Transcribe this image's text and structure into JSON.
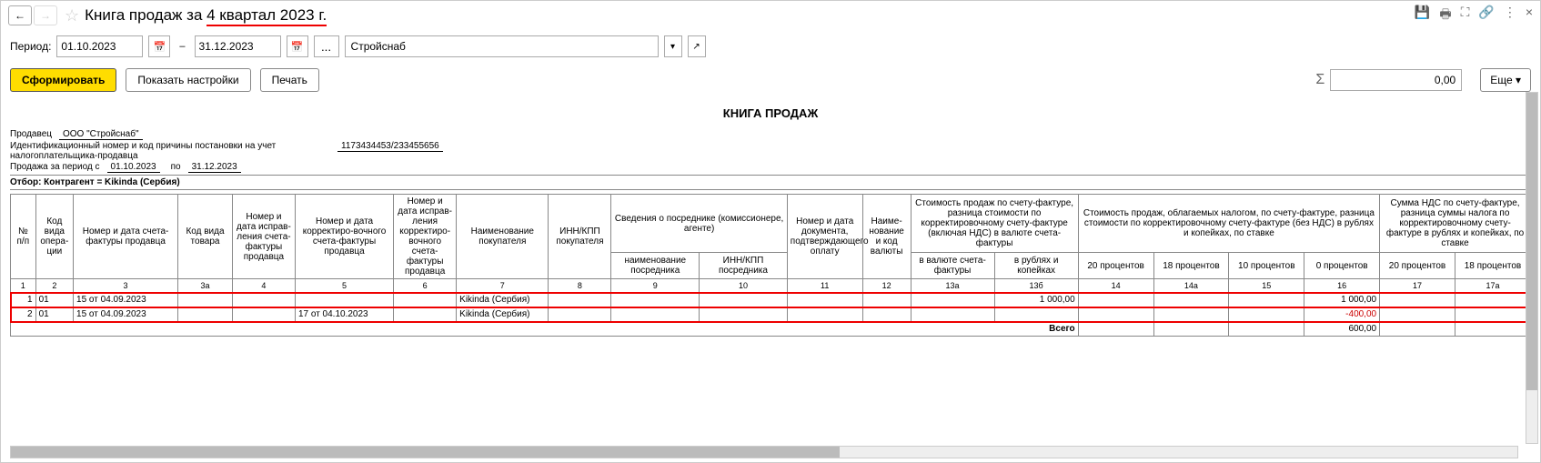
{
  "titlebar": {
    "title_prefix": "Книга продаж за ",
    "title_highlight": "4 квартал 2023 г."
  },
  "toolbar": {
    "period_label": "Период:",
    "date_from": "01.10.2023",
    "date_to": "31.12.2023",
    "dots": "...",
    "org": "Стройснаб"
  },
  "actions": {
    "generate": "Сформировать",
    "settings": "Показать настройки",
    "print": "Печать",
    "sum_value": "0,00",
    "more": "Еще"
  },
  "report": {
    "title": "КНИГА ПРОДАЖ",
    "seller_label": "Продавец",
    "seller": "ООО \"Стройснаб\"",
    "inn_label": "Идентификационный номер и код причины постановки на учет налогоплательщика-продавца",
    "inn": "1173434453/233455656",
    "period_label_from": "Продажа за период с",
    "period_from": "01.10.2023",
    "period_label_to": "по",
    "period_to": "31.12.2023",
    "filter": "Отбор: Контрагент = Kikinda (Сербия)"
  },
  "headers": {
    "n": "№ п/п",
    "op": "Код вида опера-ции",
    "sf": "Номер и дата счета-фактуры продавца",
    "kind": "Код вида товара",
    "corr": "Номер и дата исправ-ления счета-фактуры продавца",
    "corrd": "Номер и дата корректиро-вочного счета-фактуры продавца",
    "corr2": "Номер и дата исправ-ления корректиро-вочного счета-фактуры продавца",
    "buyer": "Наименование покупателя",
    "inn": "ИНН/КПП покупателя",
    "agent_group": "Сведения о посреднике (комиссионере, агенте)",
    "agent1": "наименование посредника",
    "agent2": "ИНН/КПП посредника",
    "pay": "Номер и дата документа, подтверждающего оплату",
    "cur": "Наиме-нование и код валюты",
    "cost_group": "Стоимость продаж по счету-фактуре, разница стоимости по корректировочному счету-фактуре (включая НДС) в валюте счета-фактуры",
    "cost1": "в валюте счета-фактуры",
    "cost2": "в рублях и копейках",
    "taxable_group": "Стоимость продаж, облагаемых налогом, по счету-фактуре, разница стоимости по корректировочному счету-фактуре (без НДС) в рублях и копейках, по ставке",
    "p20": "20 процентов",
    "p18": "18 процентов",
    "p10": "10 процентов",
    "p0": "0 процентов",
    "vat_group": "Сумма НДС по счету-фактуре, разница суммы налога по корректировочному счету-фактуре в рублях и копейках, по ставке",
    "v20": "20 процентов",
    "v18": "18 процентов"
  },
  "colnums": {
    "c1": "1",
    "c2": "2",
    "c3": "3",
    "c3a": "3а",
    "c4": "4",
    "c5": "5",
    "c6": "6",
    "c7": "7",
    "c8": "8",
    "c9": "9",
    "c10": "10",
    "c11": "11",
    "c12": "12",
    "c13a": "13а",
    "c13b": "13б",
    "c14": "14",
    "c14a": "14а",
    "c15": "15",
    "c16": "16",
    "c17": "17",
    "c17a": "17а"
  },
  "rows": [
    {
      "n": "1",
      "op": "01",
      "sf": "15 от 04.09.2023",
      "corrd": "",
      "buyer": "Kikinda (Сербия)",
      "cost2": "1 000,00",
      "p0": "1 000,00",
      "p0_neg": false
    },
    {
      "n": "2",
      "op": "01",
      "sf": "15 от 04.09.2023",
      "corrd": "17 от 04.10.2023",
      "buyer": "Kikinda (Сербия)",
      "cost2": "",
      "p0": "-400,00",
      "p0_neg": true
    }
  ],
  "total": {
    "label": "Всего",
    "p0": "600,00"
  }
}
